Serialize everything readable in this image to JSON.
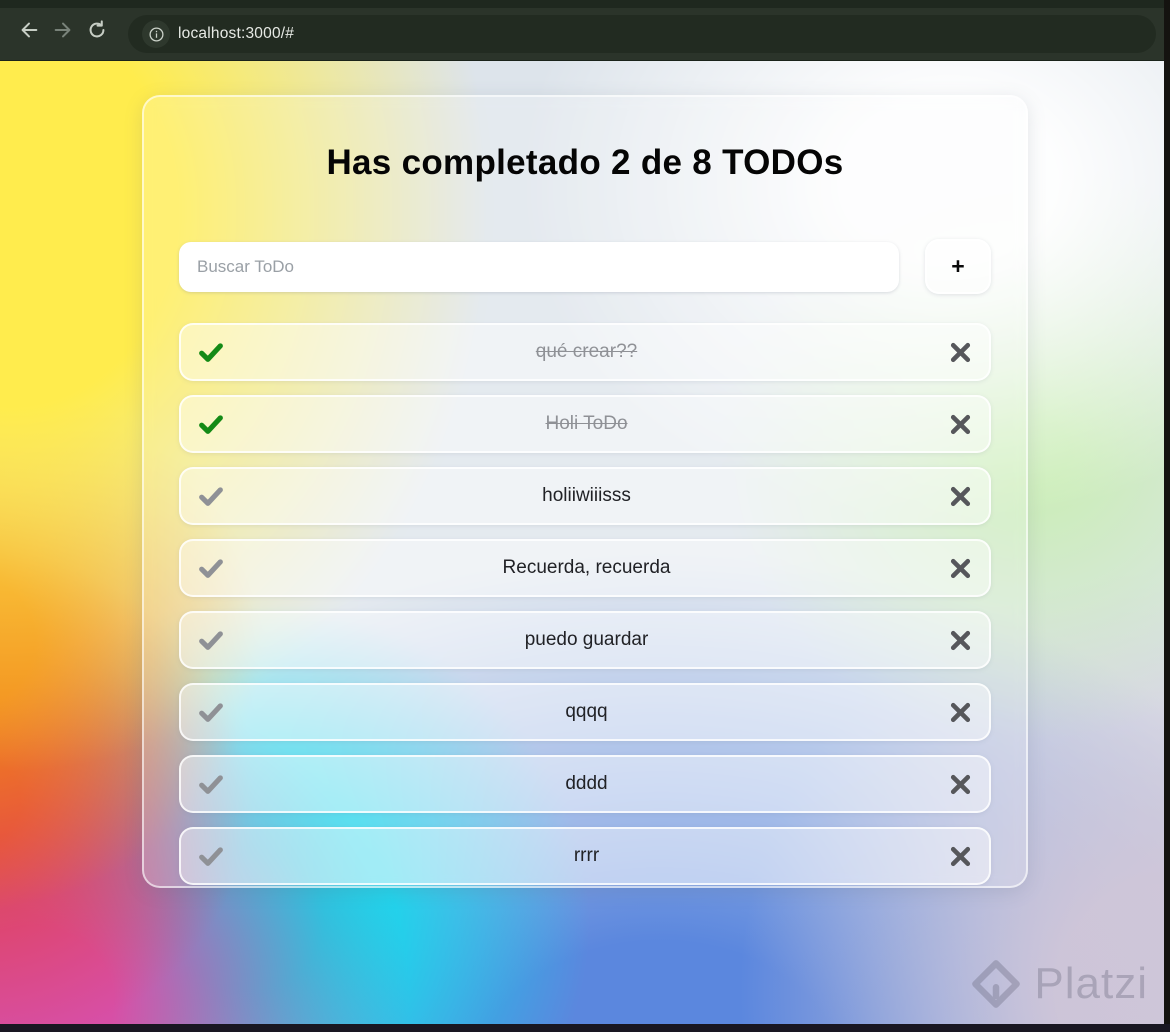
{
  "browser": {
    "url": "localhost:3000/#",
    "back_icon": "arrow-left",
    "forward_icon": "arrow-right",
    "reload_icon": "reload",
    "info_icon": "info-circle"
  },
  "app": {
    "title": "Has completado 2 de 8 TODOs",
    "completed_count": 2,
    "total_count": 8,
    "search": {
      "placeholder": "Buscar ToDo",
      "value": ""
    },
    "add_button_label": "+",
    "todos": [
      {
        "text": "qué crear??",
        "completed": true
      },
      {
        "text": "Holi ToDo",
        "completed": true
      },
      {
        "text": "holiiwiiisss",
        "completed": false
      },
      {
        "text": "Recuerda, recuerda",
        "completed": false
      },
      {
        "text": "puedo guardar",
        "completed": false
      },
      {
        "text": "qqqq",
        "completed": false
      },
      {
        "text": "dddd",
        "completed": false
      },
      {
        "text": "rrrr",
        "completed": false
      }
    ]
  },
  "watermark": {
    "label": "Platzi"
  },
  "colors": {
    "toolbar": "#2b342a",
    "url_pill": "#222b21",
    "check_done": "#148a16",
    "check_pending": "#8f9196",
    "delete_x": "#56575b",
    "gradient_yellow": "#ffec4d",
    "gradient_orange": "#f18419",
    "gradient_red": "#e2404f",
    "gradient_magenta": "#d74fa6",
    "gradient_cyan": "#00e2ee",
    "gradient_blue": "#5b87de"
  }
}
